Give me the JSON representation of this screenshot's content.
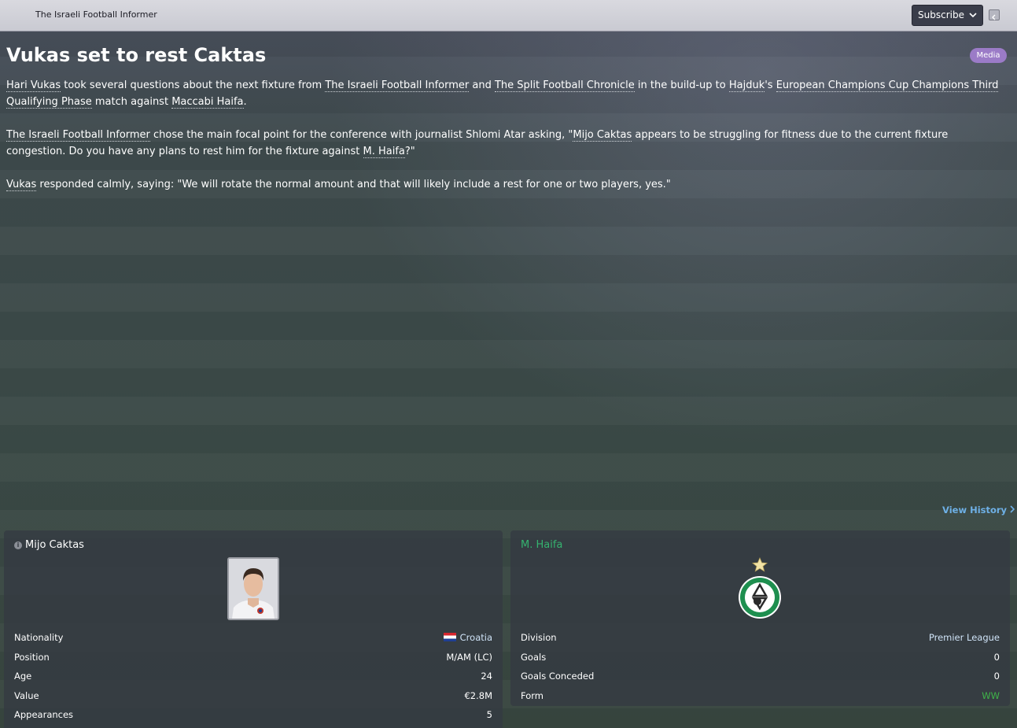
{
  "topbar": {
    "publication": "The Israeli Football Informer",
    "subscribe_label": "Subscribe"
  },
  "article": {
    "title": "Vukas set to rest Caktas",
    "category": "Media",
    "p1": {
      "a": "Hari Vukas",
      "b": " took several questions about the next fixture from ",
      "c": "The Israeli Football Informer",
      "d": " and ",
      "e": "The Split Football Chronicle",
      "f": " in the build-up to ",
      "g": "Hajduk",
      "h": "'s ",
      "i": "European Champions Cup Champions Third Qualifying Phase",
      "j": " match against ",
      "k": "Maccabi Haifa",
      "l": "."
    },
    "p2": {
      "a": "The Israeli Football Informer",
      "b": " chose the main focal point for the conference with journalist Shlomi Atar asking, \"",
      "c": "Mijo Caktas",
      "d": " appears to be struggling for fitness due to the current fixture congestion. Do you have any plans to rest him for the fixture against ",
      "e": "M. Haifa",
      "f": "?\""
    },
    "p3": {
      "a": "Vukas",
      "b": " responded calmly, saying: \"We will rotate the normal amount and that will likely include a rest for one or two players, yes.\""
    },
    "view_history": "View History"
  },
  "player_panel": {
    "name": "Mijo Caktas",
    "rows": [
      {
        "key": "Nationality",
        "value": "Croatia"
      },
      {
        "key": "Position",
        "value": "M/AM (LC)"
      },
      {
        "key": "Age",
        "value": "24"
      },
      {
        "key": "Value",
        "value": "€2.8M"
      },
      {
        "key": "Appearances",
        "value": "5"
      }
    ]
  },
  "team_panel": {
    "name": "M. Haifa",
    "rows": [
      {
        "key": "Division",
        "value": "Premier League"
      },
      {
        "key": "Goals",
        "value": "0"
      },
      {
        "key": "Goals Conceded",
        "value": "0"
      },
      {
        "key": "Form",
        "value": "WW"
      }
    ]
  },
  "colors": {
    "link_blue": "#6eb0e6",
    "team_green": "#35b26f",
    "form_green": "#3fb449",
    "badge_purple": "#9b7bc7"
  }
}
